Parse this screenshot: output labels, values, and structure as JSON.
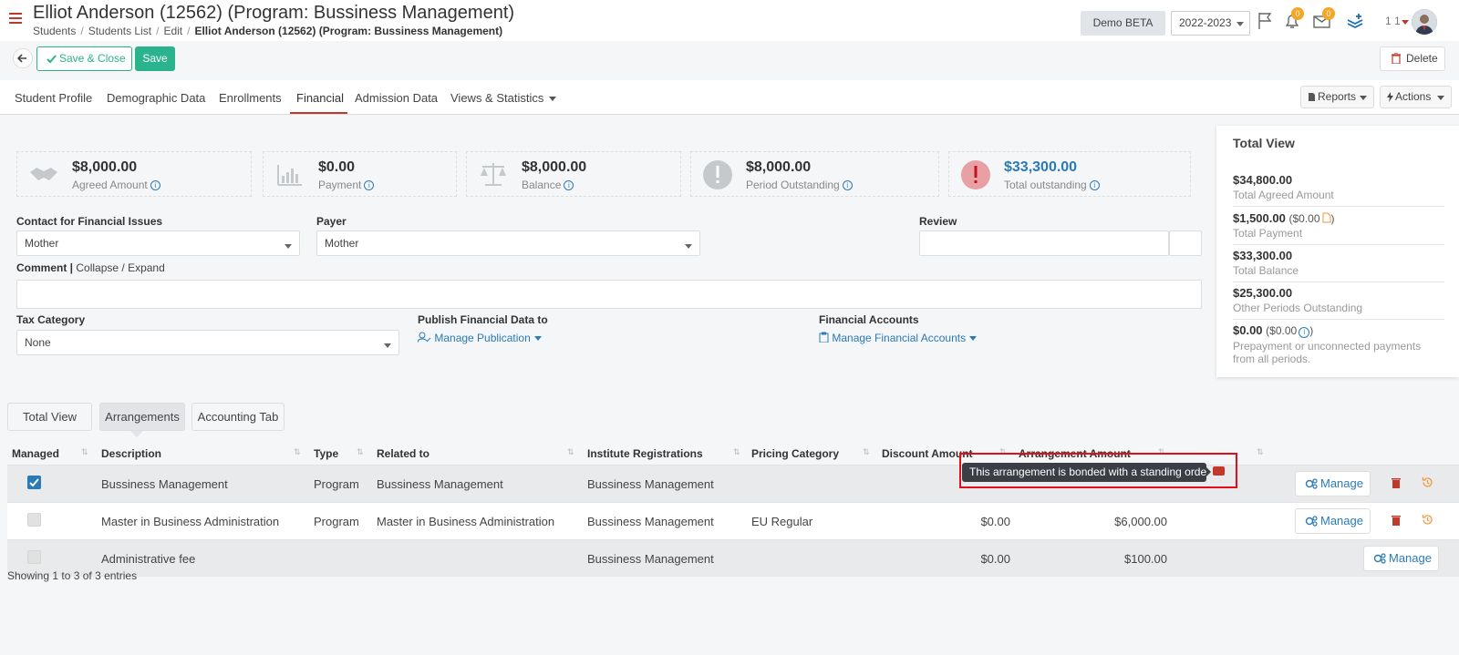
{
  "header": {
    "title": "Elliot Anderson (12562) (Program: Bussiness Management)",
    "breadcrumb": [
      "Students",
      "Students List",
      "Edit",
      "Elliot Anderson (12562) (Program: Bussiness Management)"
    ],
    "demo_label": "Demo BETA",
    "year": "2022-2023",
    "notif_count": "0",
    "mail_count": "0",
    "user_nums": "1 1"
  },
  "toolbar": {
    "save_close_label": "Save & Close",
    "save_label": "Save",
    "delete_label": "Delete"
  },
  "tabs": [
    "Student Profile",
    "Demographic Data",
    "Enrollments",
    "Financial",
    "Admission Data",
    "Views & Statistics"
  ],
  "top_buttons": {
    "reports": "Reports",
    "actions": "Actions"
  },
  "stats": [
    {
      "value": "$8,000.00",
      "label": "Agreed Amount",
      "icon": "handshake-icon"
    },
    {
      "value": "$0.00",
      "label": "Payment",
      "icon": "bar-chart-icon"
    },
    {
      "value": "$8,000.00",
      "label": "Balance",
      "icon": "scale-icon"
    },
    {
      "value": "$8,000.00",
      "label": "Period Outstanding",
      "icon": "alert-icon"
    },
    {
      "value": "$33,300.00",
      "label": "Total outstanding",
      "icon": "alert-red-icon"
    }
  ],
  "form": {
    "contact_label": "Contact for Financial Issues",
    "contact_value": "Mother",
    "payer_label": "Payer",
    "payer_value": "Mother",
    "review_label": "Review",
    "comment_label": "Comment",
    "collapse_label": "Collapse / Expand",
    "tax_label": "Tax Category",
    "tax_value": "None",
    "publish_label": "Publish Financial Data to",
    "publish_link": "Manage Publication",
    "accounts_label": "Financial Accounts",
    "accounts_link": "Manage Financial Accounts"
  },
  "total_view": {
    "title": "Total View",
    "rows": [
      {
        "value": "$34,800.00",
        "sub": "",
        "label": "Total Agreed Amount"
      },
      {
        "value": "$1,500.00",
        "sub": "($0.00",
        "label": "Total Payment"
      },
      {
        "value": "$33,300.00",
        "sub": "",
        "label": "Total Balance"
      },
      {
        "value": "$25,300.00",
        "sub": "",
        "label": "Other Periods Outstanding"
      },
      {
        "value": "$0.00",
        "sub": "($0.00",
        "label": "Prepayment or unconnected payments",
        "label2": "from all periods."
      }
    ]
  },
  "subtabs": [
    "Total View",
    "Arrangements",
    "Accounting Tab"
  ],
  "table": {
    "columns": [
      "Managed",
      "Description",
      "Type",
      "Related to",
      "Institute Registrations",
      "Pricing Category",
      "Discount Amount",
      "Arrangement Amount"
    ],
    "rows": [
      {
        "managed": true,
        "description": "Bussiness Management",
        "type": "Program",
        "related": "Bussiness Management",
        "institute": "Bussiness Management",
        "pricing": "",
        "discount": "",
        "amount": "",
        "manage": "Manage"
      },
      {
        "managed": false,
        "description": "Master in Business Administration",
        "type": "Program",
        "related": "Master in Business Administration",
        "institute": "Bussiness Management",
        "pricing": "EU Regular",
        "discount": "$0.00",
        "amount": "$6,000.00",
        "manage": "Manage"
      },
      {
        "managed": false,
        "description": "Administrative fee",
        "type": "",
        "related": "",
        "institute": "Bussiness Management",
        "pricing": "",
        "discount": "$0.00",
        "amount": "$100.00",
        "manage": "Manage"
      }
    ],
    "tooltip": "This arrangement is bonded with a standing order",
    "entries": "Showing 1 to 3 of 3 entries"
  },
  "colors": {
    "accent": "#2bb38d",
    "brand_red": "#c0392b",
    "link": "#2a7ab8"
  }
}
